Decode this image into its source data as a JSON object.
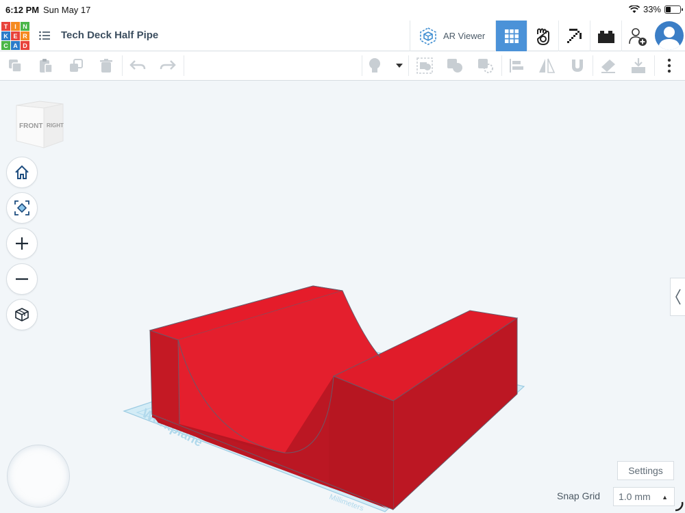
{
  "status_bar": {
    "time": "6:12 PM",
    "date": "Sun May 17",
    "battery_percent": "33%",
    "battery_level": 0.33
  },
  "logo": {
    "letters": [
      "T",
      "I",
      "N",
      "K",
      "E",
      "R",
      "C",
      "A",
      "D"
    ],
    "colors": [
      "#e8433a",
      "#f58a1f",
      "#4ab648",
      "#2c7bc9",
      "#e8433a",
      "#f58a1f",
      "#4ab648",
      "#2c7bc9",
      "#e8433a"
    ]
  },
  "header": {
    "design_title": "Tech Deck Half Pipe",
    "ar_viewer_label": "AR Viewer"
  },
  "top_icons": [
    "grid-view-icon",
    "blocks-icon",
    "minecraft-pickaxe-icon",
    "lego-brick-icon",
    "add-user-icon",
    "user-avatar"
  ],
  "toolbar": [
    "copy-icon",
    "paste-icon",
    "duplicate-icon",
    "delete-icon",
    "undo-icon",
    "redo-icon",
    "light-bulb-icon",
    "dropdown-icon",
    "group-icon",
    "solid-icon",
    "hole-icon",
    "align-icon",
    "mirror-icon",
    "magnet-icon",
    "note-icon",
    "import-icon",
    "more-icon"
  ],
  "viewcube": {
    "front": "FRONT",
    "right": "RIGHT"
  },
  "nav_buttons": [
    "home-icon",
    "fit-view-icon",
    "zoom-in-icon",
    "zoom-out-icon",
    "perspective-icon"
  ],
  "workplane": {
    "label": "Workplane",
    "units": "Millimeters"
  },
  "settings_label": "Settings",
  "snap_grid": {
    "label": "Snap Grid",
    "value": "1.0 mm"
  },
  "colors": {
    "shape_front": "#e51c2a",
    "shape_side": "#b81722",
    "shape_dark": "#c41924",
    "active_blue": "#4b92d8",
    "workplane": "#cde9f4"
  }
}
